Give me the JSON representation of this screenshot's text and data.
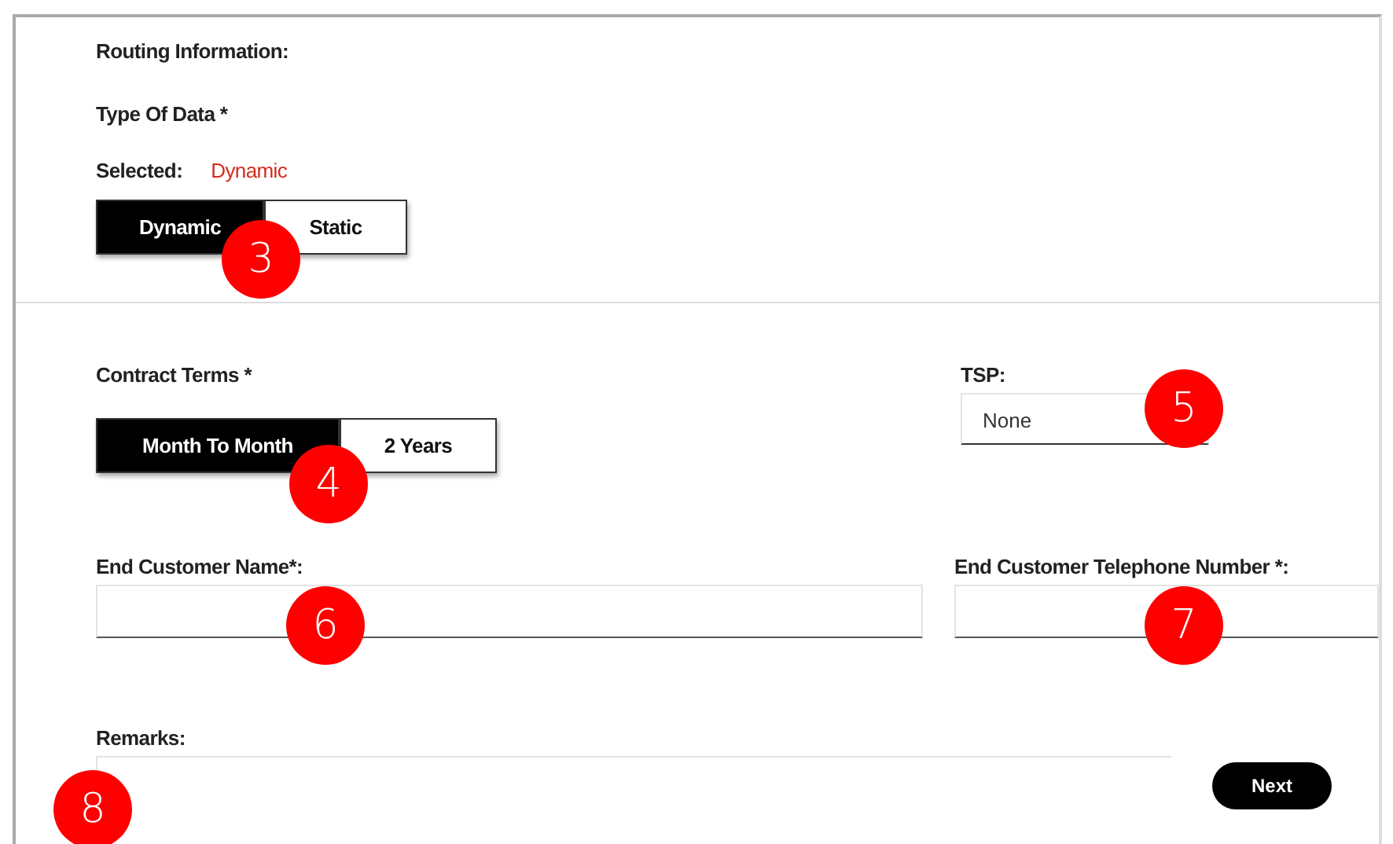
{
  "routing_heading": "Routing Information:",
  "type_of_data": {
    "label": "Type Of Data *",
    "selected_label": "Selected:",
    "selected_value": "Dynamic",
    "marker": "3",
    "options": [
      {
        "label": "Dynamic",
        "selected": true
      },
      {
        "label": "Static",
        "selected": false
      }
    ]
  },
  "contract_terms": {
    "label": "Contract Terms *",
    "marker": "4",
    "options": [
      {
        "label": "Month To Month",
        "selected": true
      },
      {
        "label": "2 Years",
        "selected": false
      }
    ]
  },
  "tsp": {
    "label": "TSP:",
    "value": "None",
    "marker": "5"
  },
  "end_customer_name": {
    "label": "End Customer Name*:",
    "marker": "6"
  },
  "end_customer_phone": {
    "label": "End Customer Telephone Number *:",
    "marker": "7"
  },
  "remarks": {
    "label": "Remarks:",
    "marker": "8"
  },
  "next_button": "Next"
}
